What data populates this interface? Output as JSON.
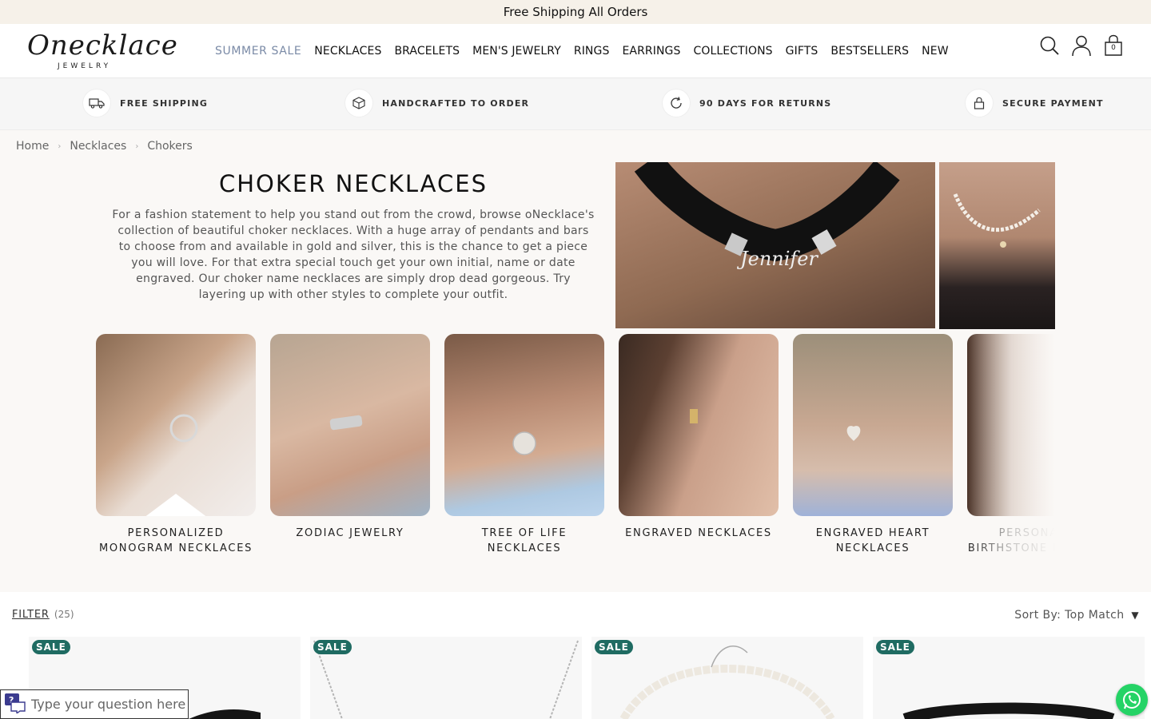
{
  "announcement": "Free Shipping All Orders",
  "brand": {
    "script": "Onecklace",
    "sub": "JEWELRY"
  },
  "nav": [
    {
      "label": "SUMMER SALE"
    },
    {
      "label": "NECKLACES"
    },
    {
      "label": "BRACELETS"
    },
    {
      "label": "MEN'S JEWELRY"
    },
    {
      "label": "RINGS"
    },
    {
      "label": "EARRINGS"
    },
    {
      "label": "COLLECTIONS"
    },
    {
      "label": "GIFTS"
    },
    {
      "label": "BESTSELLERS"
    },
    {
      "label": "NEW"
    }
  ],
  "header_icons": [
    "search-icon",
    "account-icon",
    "cart-icon"
  ],
  "cart_count": "0",
  "usp": [
    {
      "icon": "truck-icon",
      "label": "FREE SHIPPING"
    },
    {
      "icon": "box-icon",
      "label": "HANDCRAFTED TO ORDER"
    },
    {
      "icon": "refresh-icon",
      "label": "90 DAYS FOR RETURNS"
    },
    {
      "icon": "lock-icon",
      "label": "SECURE PAYMENT"
    }
  ],
  "breadcrumb": [
    "Home",
    "Necklaces",
    "Chokers"
  ],
  "page": {
    "title": "CHOKER NECKLACES",
    "description": "For a fashion statement to help you stand out from the crowd, browse oNecklace's collection of beautiful choker necklaces. With a huge array of pendants and bars to choose from and available in gold and silver, this is the chance to get a piece you will love. For that extra special touch get your own initial, name or date engraved. Our choker name necklaces are simply drop dead gorgeous. Try layering up with other styles to complete your outfit."
  },
  "hero": {
    "engraving": "Jennifer"
  },
  "categories": [
    {
      "label": "PERSONALIZED MONOGRAM NECKLACES"
    },
    {
      "label": "ZODIAC JEWELRY"
    },
    {
      "label": "TREE OF LIFE NECKLACES"
    },
    {
      "label": "ENGRAVED NECKLACES"
    },
    {
      "label": "ENGRAVED HEART NECKLACES"
    },
    {
      "label": "PERSONALIZED BIRTHSTONE NECKLACES"
    }
  ],
  "filter": {
    "label": "FILTER",
    "count": "(25)"
  },
  "sort": {
    "label": "Sort By:",
    "value": "Top Match"
  },
  "products": [
    {
      "badge": "SALE"
    },
    {
      "badge": "SALE"
    },
    {
      "badge": "SALE"
    },
    {
      "badge": "SALE"
    }
  ],
  "chat": {
    "placeholder": "Type your question here"
  },
  "colors": {
    "accent": "#1f6b62",
    "announcement_bg": "#f6f1e9",
    "sale_nav": "#7a8aa6",
    "whatsapp": "#25d366"
  }
}
